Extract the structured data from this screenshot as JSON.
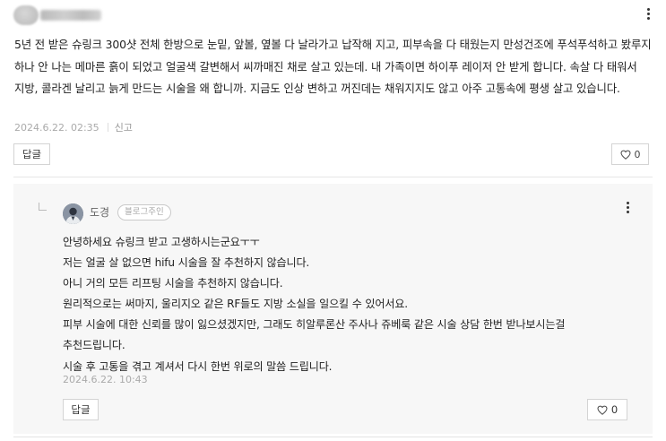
{
  "comment": {
    "author_name": "",
    "text": "5년 전 받은 슈링크 300샷 전체 한방으로 눈밑, 앞볼, 옆볼 다 날라가고 납작해 지고, 피부속을 다 태웠는지 만성건조에 푸석푸석하고 봤루지 하나 안 나는 메마른 흙이 되었고 얼굴색 갈변해서 씨까매진 채로 살고 있는데. 내 가족이면 하이푸 레이저 안 받게 합니다. 속살 다 태워서 지방, 콜라겐 날리고 늙게 만드는 시술을 왜 합니까. 지금도 인상 변하고 꺼진데는 채워지지도 않고 아주 고통속에 평생 살고 있습니다.",
    "date": "2024.6.22. 02:35",
    "report_label": "신고",
    "reply_button_label": "답글",
    "like_count": "0"
  },
  "reply": {
    "author_name": "도경",
    "badge_label": "블로그주인",
    "lines": [
      "안녕하세요 슈링크 받고 고생하시는군요ㅜㅜ",
      "저는 얼굴 살 없으면 hifu 시술을 잘 추천하지 않습니다.",
      "아니 거의 모든 리프팅 시술을 추천하지 않습니다.",
      "원리적으로는 써마지, 울리지오 같은 RF들도 지방 소실을 일으킬 수 있어서요.",
      "피부 시술에 대한 신뢰를 많이 잃으셨겠지만, 그래도 히알루론산 주사나 쥬베룩 같은 시술 상담 한번 받나보시는걸",
      "추천드립니다.",
      "시술 후 고통을 겪고 계셔서 다시 한번 위로의 말씀 드립니다."
    ],
    "date": "2024.6.22. 10:43",
    "reply_button_label": "답글",
    "like_count": "0"
  },
  "icons": {
    "more": "more-vertical-icon",
    "like": "heart-outline-icon",
    "reply_indent": "reply-corner-icon"
  },
  "colors": {
    "reply_background": "#f7f7f7",
    "meta_text": "#aaaaaa",
    "border": "#d4d4d4"
  }
}
